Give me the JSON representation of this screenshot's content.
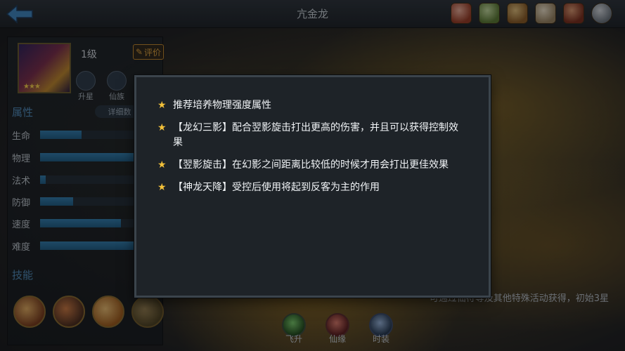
{
  "header": {
    "title": "亢金龙",
    "icons": [
      "bowl-icon",
      "scroll-icon",
      "coin-icon",
      "paper-icon",
      "book-icon",
      "magnifier-icon"
    ]
  },
  "hero": {
    "level": "1级",
    "rate_label": "评价",
    "stars": "★★★",
    "sub_buttons": [
      {
        "label": "升星"
      },
      {
        "label": "仙族"
      }
    ]
  },
  "attributes": {
    "title": "属性",
    "detail_label": "详细数",
    "stats": [
      {
        "label": "生命",
        "value": 0.43
      },
      {
        "label": "物理",
        "value": 1.0
      },
      {
        "label": "法术",
        "value": 0.06
      },
      {
        "label": "防御",
        "value": 0.34
      },
      {
        "label": "速度",
        "value": 0.83
      },
      {
        "label": "难度",
        "value": 1.0
      }
    ]
  },
  "skills": {
    "title": "技能"
  },
  "acquire": {
    "text": "可通过仙符等及其他特殊活动获得，初始3星"
  },
  "bottom_tabs": [
    {
      "label": "飞升"
    },
    {
      "label": "仙缘"
    },
    {
      "label": "时装"
    }
  ],
  "modal": {
    "tips": [
      {
        "text": "推荐培养物理强度属性"
      },
      {
        "text": "【龙幻三影】配合翌影旋击打出更高的伤害，并且可以获得控制效果"
      },
      {
        "text": "【翌影旋击】在幻影之间距离比较低的时候才用会打出更佳效果"
      },
      {
        "text": "【神龙天降】受控后使用将起到反客为主的作用"
      }
    ]
  }
}
